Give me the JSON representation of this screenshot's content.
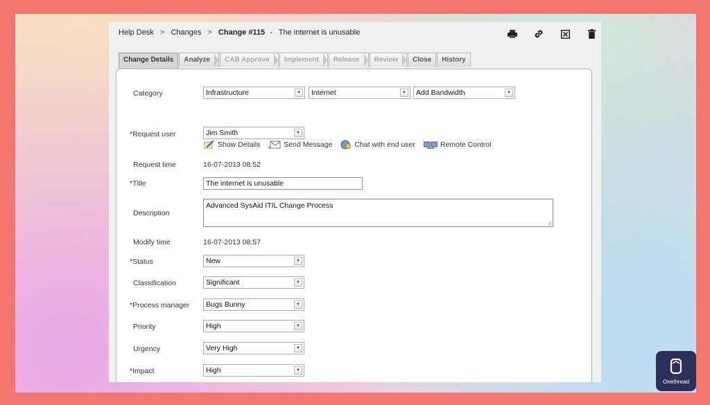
{
  "breadcrumb": {
    "items": [
      "Help Desk",
      "Changes"
    ],
    "separator": ">",
    "current": "Change #115",
    "dash": "-",
    "title": "The internet is unusable"
  },
  "toolbar": {
    "icons": [
      "print-icon",
      "link-icon",
      "close-box-icon",
      "trash-icon"
    ]
  },
  "tabs": [
    {
      "label": "Change Details",
      "state": "active"
    },
    {
      "label": "Analyze",
      "state": "enabled"
    },
    {
      "label": "CAB Approve",
      "state": "disabled"
    },
    {
      "label": "Implement",
      "state": "disabled"
    },
    {
      "label": "Release",
      "state": "disabled"
    },
    {
      "label": "Review",
      "state": "disabled"
    },
    {
      "label": "Close",
      "state": "enabled"
    },
    {
      "label": "History",
      "state": "enabled"
    }
  ],
  "form": {
    "category": {
      "label": "Category",
      "values": [
        "Infrastructure",
        "Internet",
        "Add Bandwidth"
      ]
    },
    "request_user": {
      "label": "*Request user",
      "value": "Jim Smith"
    },
    "user_actions": {
      "show_details": "Show Details",
      "send_message": "Send Message",
      "chat": "Chat with end user",
      "remote_control": "Remote Control"
    },
    "request_time": {
      "label": "Request time",
      "value": "16-07-2013 08:52"
    },
    "title": {
      "label": "*Title",
      "value": "The internet is unusable"
    },
    "description": {
      "label": "Description",
      "value": "Advanced SysAid ITIL Change Process"
    },
    "modify_time": {
      "label": "Modify time",
      "value": "16-07-2013 08:57"
    },
    "status": {
      "label": "*Status",
      "value": "New"
    },
    "classification": {
      "label": "Classification",
      "value": "Significant"
    },
    "process_manager": {
      "label": "*Process manager",
      "value": "Bugs Bunny"
    },
    "priority": {
      "label": "Priority",
      "value": "High"
    },
    "urgency": {
      "label": "Urgency",
      "value": "Very High"
    },
    "impact": {
      "label": "*Impact",
      "value": "High"
    }
  },
  "brand": {
    "name": "Onethread",
    "color": "#2c2f5a",
    "frame_color": "#f4766e"
  }
}
